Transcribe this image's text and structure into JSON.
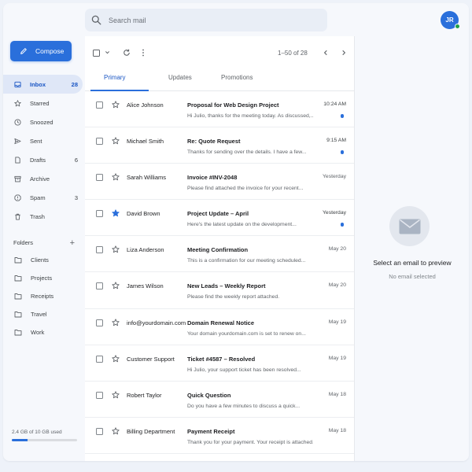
{
  "search": {
    "placeholder": "Search mail"
  },
  "user": {
    "initials": "JR"
  },
  "compose_label": "Compose",
  "nav": [
    {
      "label": "Inbox",
      "count": "28",
      "icon": "inbox-icon",
      "active": true
    },
    {
      "label": "Starred",
      "count": "",
      "icon": "star-icon"
    },
    {
      "label": "Snoozed",
      "count": "",
      "icon": "clock-icon"
    },
    {
      "label": "Sent",
      "count": "",
      "icon": "send-icon"
    },
    {
      "label": "Drafts",
      "count": "6",
      "icon": "draft-icon"
    },
    {
      "label": "Archive",
      "count": "",
      "icon": "archive-icon"
    },
    {
      "label": "Spam",
      "count": "3",
      "icon": "spam-icon"
    },
    {
      "label": "Trash",
      "count": "",
      "icon": "trash-icon"
    }
  ],
  "folders_heading": "Folders",
  "folders": [
    "Clients",
    "Projects",
    "Receipts",
    "Travel",
    "Work"
  ],
  "storage": {
    "text": "2.4 GB of 10 GB used",
    "fraction": 0.24
  },
  "pagination": "1–50 of 28",
  "tabs": [
    "Primary",
    "Updates",
    "Promotions"
  ],
  "emails": [
    {
      "sender": "Alice Johnson",
      "subject": "Proposal for Web Design Project",
      "snippet": "Hi Julio, thanks for the meeting today. As discussed,...",
      "date": "10:24 AM",
      "unread": true,
      "starred": false
    },
    {
      "sender": "Michael Smith",
      "subject": "Re: Quote Request",
      "snippet": "Thanks for sending over the details. I have a few...",
      "date": "9:15 AM",
      "unread": true,
      "starred": false
    },
    {
      "sender": "Sarah Williams",
      "subject": "Invoice #INV-2048",
      "snippet": "Please find attached the invoice for your recent...",
      "date": "Yesterday",
      "unread": false,
      "starred": false
    },
    {
      "sender": "David Brown",
      "subject": "Project Update – April",
      "snippet": "Here's the latest update on the development...",
      "date": "Yesterday",
      "unread": true,
      "starred": true
    },
    {
      "sender": "Liza Anderson",
      "subject": "Meeting Confirmation",
      "snippet": "This is a confirmation for our meeting scheduled...",
      "date": "May 20",
      "unread": false,
      "starred": false
    },
    {
      "sender": "James Wilson",
      "subject": "New Leads – Weekly Report",
      "snippet": "Please find the weekly report attached.",
      "date": "May 20",
      "unread": false,
      "starred": false
    },
    {
      "sender": "info@yourdomain.com",
      "subject": "Domain Renewal Notice",
      "snippet": "Your domain yourdomain.com is set to renew on...",
      "date": "May 19",
      "unread": false,
      "starred": false
    },
    {
      "sender": "Customer Support",
      "subject": "Ticket #4587 – Resolved",
      "snippet": "Hi Julio, your support ticket has been resolved...",
      "date": "May 19",
      "unread": false,
      "starred": false
    },
    {
      "sender": "Robert Taylor",
      "subject": "Quick Question",
      "snippet": "Do you have a few minutes to discuss a quick...",
      "date": "May 18",
      "unread": false,
      "starred": false
    },
    {
      "sender": "Billing Department",
      "subject": "Payment Receipt",
      "snippet": "Thank you for your payment. Your receipt is attached.",
      "date": "May 18",
      "unread": false,
      "starred": false
    }
  ],
  "preview": {
    "title": "Select an email to preview",
    "subtitle": "No email selected"
  },
  "colors": {
    "accent": "#2a6fdb",
    "online": "#1e9e4a"
  }
}
